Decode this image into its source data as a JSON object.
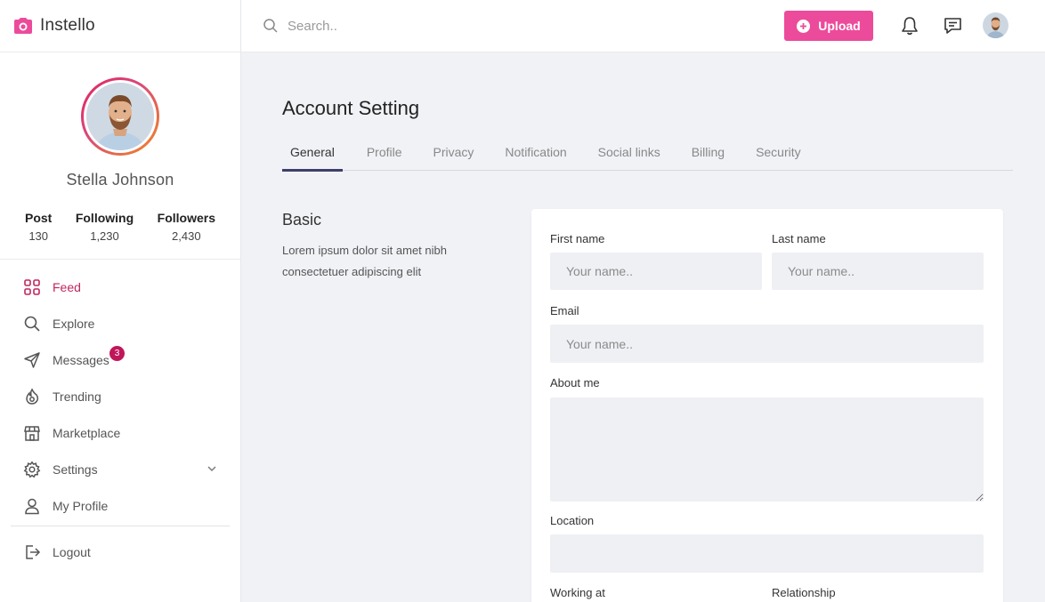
{
  "app": {
    "name": "Instello",
    "brand_color": "#ec4b9b",
    "accent_color": "#c0275f"
  },
  "search": {
    "placeholder": "Search.."
  },
  "topbar": {
    "upload_label": "Upload",
    "icons": [
      "search-icon",
      "plus-circle-icon",
      "bell-icon",
      "chat-icon",
      "avatar"
    ]
  },
  "profile": {
    "name": "Stella Johnson",
    "stats": [
      {
        "label": "Post",
        "value": "130"
      },
      {
        "label": "Following",
        "value": "1,230"
      },
      {
        "label": "Followers",
        "value": "2,430"
      }
    ]
  },
  "nav": {
    "items": [
      {
        "label": "Feed",
        "icon": "grid-icon",
        "active": true
      },
      {
        "label": "Explore",
        "icon": "search-icon"
      },
      {
        "label": "Messages",
        "icon": "send-icon",
        "badge": "3"
      },
      {
        "label": "Trending",
        "icon": "fire-icon"
      },
      {
        "label": "Marketplace",
        "icon": "store-icon"
      },
      {
        "label": "Settings",
        "icon": "gear-icon",
        "expandable": true
      },
      {
        "label": "My Profile",
        "icon": "user-icon"
      }
    ],
    "logout_label": "Logout"
  },
  "page": {
    "title": "Account Setting",
    "tabs": [
      "General",
      "Profile",
      "Privacy",
      "Notification",
      "Social links",
      "Billing",
      "Security"
    ],
    "active_tab": "General"
  },
  "section": {
    "title": "Basic",
    "description": "Lorem ipsum dolor sit amet nibh consectetuer adipiscing elit"
  },
  "form": {
    "first_name_label": "First name",
    "first_name_placeholder": "Your name..",
    "last_name_label": "Last name",
    "last_name_placeholder": "Your name..",
    "email_label": "Email",
    "email_placeholder": "Your name..",
    "about_label": "About me",
    "location_label": "Location",
    "working_at_label": "Working at",
    "relationship_label": "Relationship"
  }
}
